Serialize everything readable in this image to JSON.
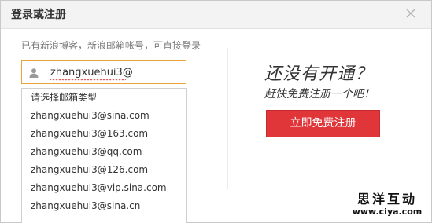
{
  "dialog": {
    "title": "登录或注册",
    "close_icon": "close-icon"
  },
  "login": {
    "hint": "已有新浪博客，新浪邮箱帐号，可直接登录",
    "username_value": "zhangxuehui3@",
    "username_icon": "user-icon"
  },
  "email_dropdown": {
    "items": [
      "请选择邮箱类型",
      "zhangxuehui3@sina.com",
      "zhangxuehui3@163.com",
      "zhangxuehui3@qq.com",
      "zhangxuehui3@126.com",
      "zhangxuehui3@vip.sina.com",
      "zhangxuehui3@sina.cn"
    ]
  },
  "register": {
    "title": "还没有开通？",
    "subtitle": "赶快免费注册一个吧！",
    "button_label": "立即免费注册",
    "button_color": "#e0363a"
  },
  "watermark": {
    "main": "思洋互动",
    "url": "www.ciya.com"
  }
}
